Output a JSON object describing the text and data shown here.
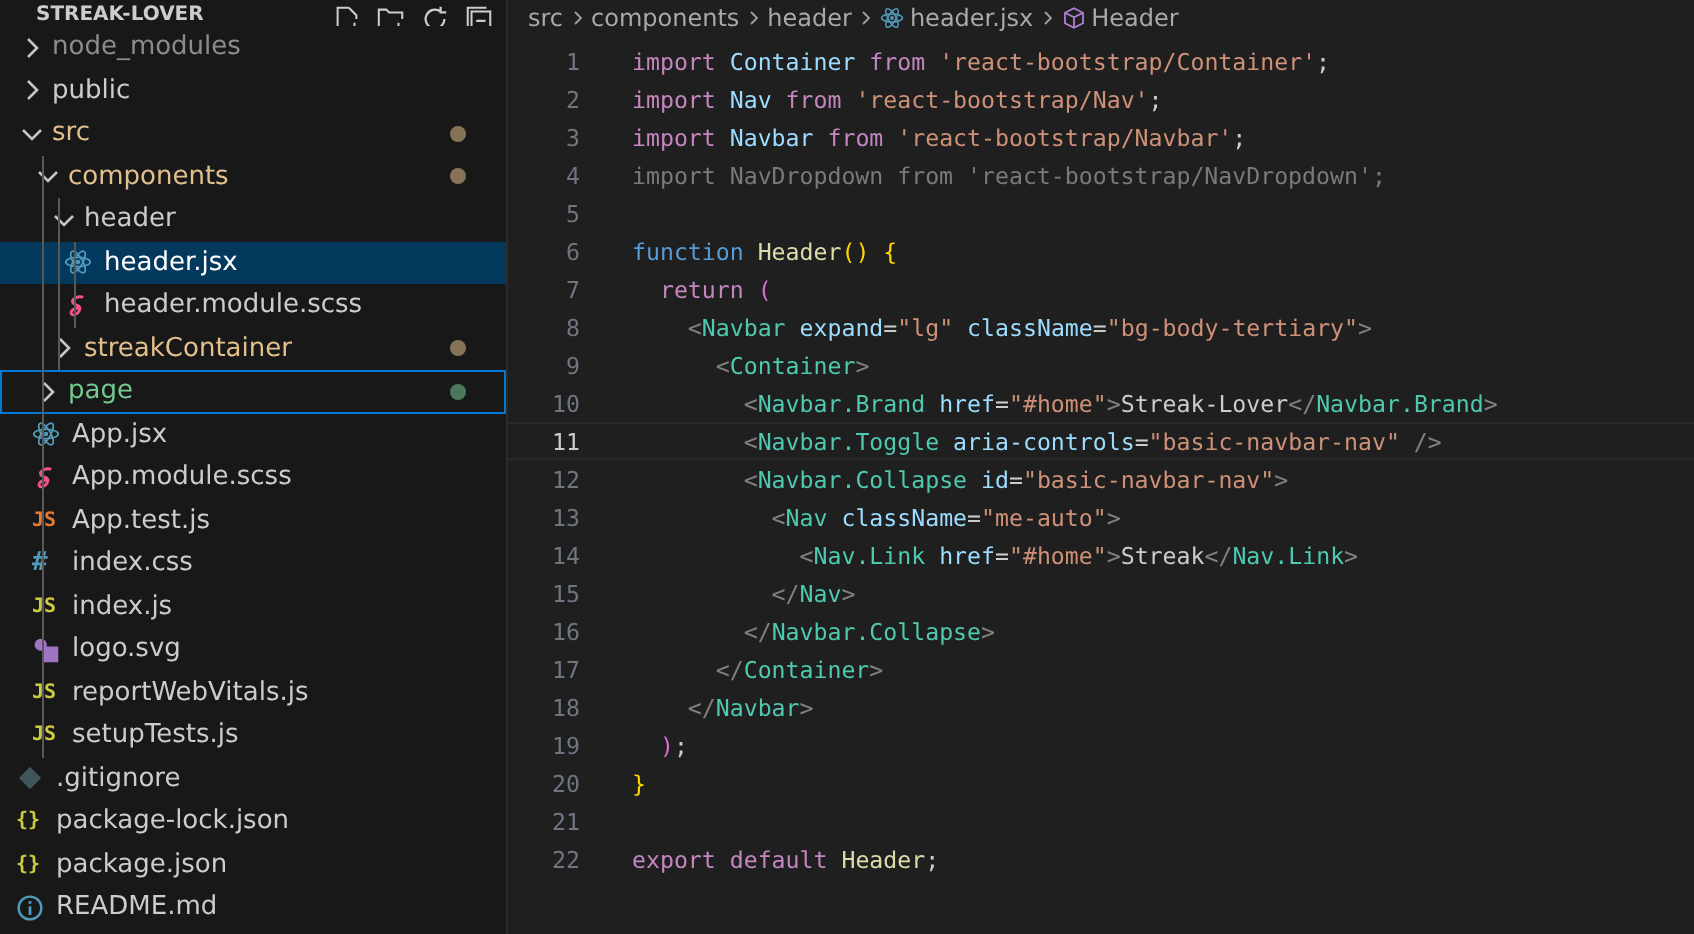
{
  "sidebar": {
    "title": "STREAK-LOVER",
    "tree": [
      {
        "name": "node_modules",
        "kind": "folder",
        "expanded": false,
        "color": "#8c8c8c",
        "badge": false,
        "selected": false,
        "focused": false
      },
      {
        "name": "public",
        "kind": "folder",
        "expanded": false,
        "color": "#cccccc",
        "badge": false,
        "selected": false,
        "focused": false
      },
      {
        "name": "src",
        "kind": "folder",
        "expanded": true,
        "color": "#e2c08d",
        "badge": true,
        "selected": false,
        "focused": false,
        "children": [
          {
            "name": "components",
            "kind": "folder",
            "expanded": true,
            "color": "#e2c08d",
            "badge": true,
            "selected": false,
            "focused": false,
            "children": [
              {
                "name": "header",
                "kind": "folder",
                "expanded": true,
                "color": "#cccccc",
                "badge": false,
                "selected": false,
                "focused": false,
                "children": [
                  {
                    "name": "header.jsx",
                    "kind": "react",
                    "color": "#ffffff",
                    "badge": false,
                    "selected": true,
                    "focused": false
                  },
                  {
                    "name": "header.module.scss",
                    "kind": "sass",
                    "color": "#cccccc",
                    "badge": false,
                    "selected": false,
                    "focused": false
                  }
                ]
              },
              {
                "name": "streakContainer",
                "kind": "folder",
                "expanded": false,
                "color": "#e2c08d",
                "badge": true,
                "selected": false,
                "focused": false
              }
            ]
          },
          {
            "name": "page",
            "kind": "folder",
            "expanded": false,
            "color": "#73c991",
            "badge": true,
            "selected": false,
            "focused": true
          },
          {
            "name": "App.jsx",
            "kind": "react",
            "color": "#cccccc",
            "badge": false,
            "selected": false,
            "focused": false
          },
          {
            "name": "App.module.scss",
            "kind": "sass",
            "color": "#cccccc",
            "badge": false,
            "selected": false,
            "focused": false
          },
          {
            "name": "App.test.js",
            "kind": "test",
            "icon_label": "JS",
            "color": "#cccccc",
            "badge": false,
            "selected": false,
            "focused": false
          },
          {
            "name": "index.css",
            "kind": "css",
            "icon_label": "#",
            "color": "#cccccc",
            "badge": false,
            "selected": false,
            "focused": false
          },
          {
            "name": "index.js",
            "kind": "js",
            "icon_label": "JS",
            "color": "#cccccc",
            "badge": false,
            "selected": false,
            "focused": false
          },
          {
            "name": "logo.svg",
            "kind": "svg",
            "color": "#cccccc",
            "badge": false,
            "selected": false,
            "focused": false
          },
          {
            "name": "reportWebVitals.js",
            "kind": "js",
            "icon_label": "JS",
            "color": "#cccccc",
            "badge": false,
            "selected": false,
            "focused": false
          },
          {
            "name": "setupTests.js",
            "kind": "js",
            "icon_label": "JS",
            "color": "#cccccc",
            "badge": false,
            "selected": false,
            "focused": false
          }
        ]
      },
      {
        "name": ".gitignore",
        "kind": "git",
        "color": "#cccccc",
        "badge": false,
        "selected": false,
        "focused": false
      },
      {
        "name": "package-lock.json",
        "kind": "json",
        "icon_label": "{}",
        "color": "#cccccc",
        "badge": false,
        "selected": false,
        "focused": false
      },
      {
        "name": "package.json",
        "kind": "json",
        "icon_label": "{}",
        "color": "#cccccc",
        "badge": false,
        "selected": false,
        "focused": false
      },
      {
        "name": "README.md",
        "kind": "info",
        "color": "#cccccc",
        "badge": false,
        "selected": false,
        "focused": false
      }
    ]
  },
  "breadcrumbs": [
    {
      "text": "src",
      "kind": "folder"
    },
    {
      "text": "components",
      "kind": "folder"
    },
    {
      "text": "header",
      "kind": "folder"
    },
    {
      "text": "header.jsx",
      "kind": "react"
    },
    {
      "text": "Header",
      "kind": "function"
    }
  ],
  "editor": {
    "lines": [
      {
        "number": "1",
        "current": false,
        "tokens": [
          {
            "text": "import",
            "kind": "control"
          },
          {
            "text": " Container ",
            "kind": "variable"
          },
          {
            "text": "from",
            "kind": "control"
          },
          {
            "text": " 'react-bootstrap/Container'",
            "kind": "string"
          },
          {
            "text": ";",
            "kind": "plain"
          }
        ]
      },
      {
        "number": "2",
        "current": false,
        "tokens": [
          {
            "text": "import",
            "kind": "control"
          },
          {
            "text": " Nav ",
            "kind": "variable"
          },
          {
            "text": "from",
            "kind": "control"
          },
          {
            "text": " 'react-bootstrap/Nav'",
            "kind": "string"
          },
          {
            "text": ";",
            "kind": "plain"
          }
        ]
      },
      {
        "number": "3",
        "current": false,
        "tokens": [
          {
            "text": "import",
            "kind": "control"
          },
          {
            "text": " Navbar ",
            "kind": "variable"
          },
          {
            "text": "from",
            "kind": "control"
          },
          {
            "text": " 'react-bootstrap/Navbar'",
            "kind": "string"
          },
          {
            "text": ";",
            "kind": "plain"
          }
        ]
      },
      {
        "number": "4",
        "current": false,
        "tokens": [
          {
            "text": "import NavDropdown from 'react-bootstrap/NavDropdown';",
            "kind": "unused"
          }
        ]
      },
      {
        "number": "5",
        "current": false
      },
      {
        "number": "6",
        "current": false,
        "tokens": [
          {
            "text": "function",
            "kind": "keyword"
          },
          {
            "text": " Header",
            "kind": "function"
          },
          {
            "text": "()",
            "kind": "bracket"
          },
          {
            "text": " {",
            "kind": "bracket"
          }
        ]
      },
      {
        "number": "7",
        "current": false,
        "tokens": [
          {
            "text": "  return",
            "kind": "control"
          },
          {
            "text": " (",
            "kind": "paren"
          }
        ]
      },
      {
        "number": "8",
        "current": false,
        "tokens": [
          {
            "text": "    <",
            "kind": "punct"
          },
          {
            "text": "Navbar",
            "kind": "tag"
          },
          {
            "text": " expand",
            "kind": "attr"
          },
          {
            "text": "=",
            "kind": "plain"
          },
          {
            "text": "\"lg\"",
            "kind": "string"
          },
          {
            "text": " className",
            "kind": "attr"
          },
          {
            "text": "=",
            "kind": "plain"
          },
          {
            "text": "\"bg-body-tertiary\"",
            "kind": "string"
          },
          {
            "text": ">",
            "kind": "punct"
          }
        ]
      },
      {
        "number": "9",
        "current": false,
        "tokens": [
          {
            "text": "      <",
            "kind": "punct"
          },
          {
            "text": "Container",
            "kind": "tag"
          },
          {
            "text": ">",
            "kind": "punct"
          }
        ]
      },
      {
        "number": "10",
        "current": false,
        "tokens": [
          {
            "text": "        <",
            "kind": "punct"
          },
          {
            "text": "Navbar.Brand",
            "kind": "tag"
          },
          {
            "text": " href",
            "kind": "attr"
          },
          {
            "text": "=",
            "kind": "plain"
          },
          {
            "text": "\"#home\"",
            "kind": "string"
          },
          {
            "text": ">",
            "kind": "punct"
          },
          {
            "text": "Streak-Lover",
            "kind": "plain"
          },
          {
            "text": "</",
            "kind": "punct"
          },
          {
            "text": "Navbar.Brand",
            "kind": "tag"
          },
          {
            "text": ">",
            "kind": "punct"
          }
        ]
      },
      {
        "number": "11",
        "current": true,
        "tokens": [
          {
            "text": "        <",
            "kind": "punct"
          },
          {
            "text": "Navbar.Toggle",
            "kind": "tag"
          },
          {
            "text": " aria-controls",
            "kind": "attr"
          },
          {
            "text": "=",
            "kind": "plain"
          },
          {
            "text": "\"basic-navbar-nav\"",
            "kind": "string"
          },
          {
            "text": " />",
            "kind": "punct"
          }
        ]
      },
      {
        "number": "12",
        "current": false,
        "tokens": [
          {
            "text": "        <",
            "kind": "punct"
          },
          {
            "text": "Navbar.Collapse",
            "kind": "tag"
          },
          {
            "text": " id",
            "kind": "attr"
          },
          {
            "text": "=",
            "kind": "plain"
          },
          {
            "text": "\"basic-navbar-nav\"",
            "kind": "string"
          },
          {
            "text": ">",
            "kind": "punct"
          }
        ]
      },
      {
        "number": "13",
        "current": false,
        "tokens": [
          {
            "text": "          <",
            "kind": "punct"
          },
          {
            "text": "Nav",
            "kind": "tag"
          },
          {
            "text": " className",
            "kind": "attr"
          },
          {
            "text": "=",
            "kind": "plain"
          },
          {
            "text": "\"me-auto\"",
            "kind": "string"
          },
          {
            "text": ">",
            "kind": "punct"
          }
        ]
      },
      {
        "number": "14",
        "current": false,
        "tokens": [
          {
            "text": "            <",
            "kind": "punct"
          },
          {
            "text": "Nav.Link",
            "kind": "tag"
          },
          {
            "text": " href",
            "kind": "attr"
          },
          {
            "text": "=",
            "kind": "plain"
          },
          {
            "text": "\"#home\"",
            "kind": "string"
          },
          {
            "text": ">",
            "kind": "punct"
          },
          {
            "text": "Streak",
            "kind": "plain"
          },
          {
            "text": "</",
            "kind": "punct"
          },
          {
            "text": "Nav.Link",
            "kind": "tag"
          },
          {
            "text": ">",
            "kind": "punct"
          }
        ]
      },
      {
        "number": "15",
        "current": false,
        "tokens": [
          {
            "text": "          </",
            "kind": "punct"
          },
          {
            "text": "Nav",
            "kind": "tag"
          },
          {
            "text": ">",
            "kind": "punct"
          }
        ]
      },
      {
        "number": "16",
        "current": false,
        "tokens": [
          {
            "text": "        </",
            "kind": "punct"
          },
          {
            "text": "Navbar.Collapse",
            "kind": "tag"
          },
          {
            "text": ">",
            "kind": "punct"
          }
        ]
      },
      {
        "number": "17",
        "current": false,
        "tokens": [
          {
            "text": "      </",
            "kind": "punct"
          },
          {
            "text": "Container",
            "kind": "tag"
          },
          {
            "text": ">",
            "kind": "punct"
          }
        ]
      },
      {
        "number": "18",
        "current": false,
        "tokens": [
          {
            "text": "    </",
            "kind": "punct"
          },
          {
            "text": "Navbar",
            "kind": "tag"
          },
          {
            "text": ">",
            "kind": "punct"
          }
        ]
      },
      {
        "number": "19",
        "current": false,
        "tokens": [
          {
            "text": "  )",
            "kind": "paren"
          },
          {
            "text": ";",
            "kind": "plain"
          }
        ]
      },
      {
        "number": "20",
        "current": false,
        "tokens": [
          {
            "text": "}",
            "kind": "bracket"
          }
        ]
      },
      {
        "number": "21",
        "current": false
      },
      {
        "number": "22",
        "current": false,
        "tokens": [
          {
            "text": "export",
            "kind": "control"
          },
          {
            "text": " default",
            "kind": "control"
          },
          {
            "text": " Header",
            "kind": "function"
          },
          {
            "text": ";",
            "kind": "plain"
          }
        ]
      }
    ]
  }
}
